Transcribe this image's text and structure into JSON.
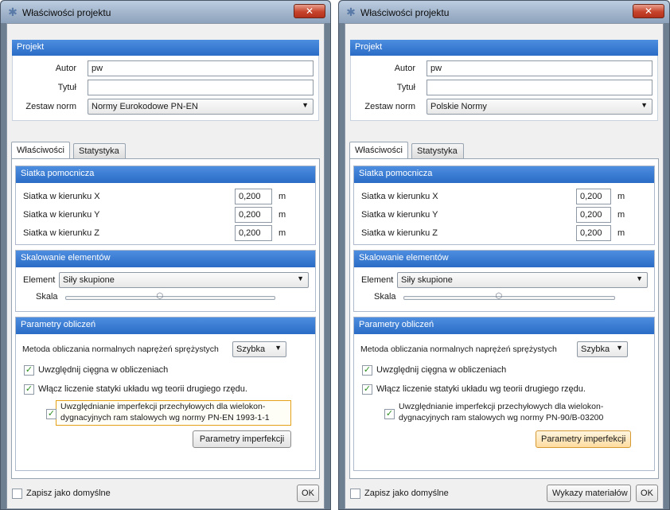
{
  "dialogs": [
    {
      "window_title": "Właściwości projektu",
      "close_glyph": "✕",
      "projekt": {
        "header": "Projekt",
        "autor_label": "Autor",
        "autor_value": "pw",
        "tytul_label": "Tytuł",
        "tytul_value": "",
        "zestaw_label": "Zestaw norm",
        "zestaw_value": "Normy Eurokodowe PN-EN"
      },
      "tabs": [
        "Właściwości",
        "Statystyka"
      ],
      "siatka": {
        "header": "Siatka pomocnicza",
        "rows": [
          {
            "label": "Siatka w kierunku X",
            "value": "0,200",
            "unit": "m"
          },
          {
            "label": "Siatka w kierunku Y",
            "value": "0,200",
            "unit": "m"
          },
          {
            "label": "Siatka w kierunku Z",
            "value": "0,200",
            "unit": "m"
          }
        ]
      },
      "skalowanie": {
        "header": "Skalowanie elementów",
        "element_label": "Element",
        "element_value": "Siły skupione",
        "skala_label": "Skala",
        "slider_level": 0.45
      },
      "parametry": {
        "header": "Parametry obliczeń",
        "metoda_label": "Metoda obliczania normalnych naprężeń sprężystych",
        "metoda_value": "Szybka",
        "check1": "Uwzględnij cięgna w obliczeniach",
        "check2": "Włącz liczenie statyki układu wg teorii drugiego rzędu.",
        "check3_line1": "Uwzględnianie imperfekcji przechyłowych dla wielokon-",
        "check3_line2": "dygnacyjnych ram stalowych wg normy PN-EN 1993-1-1",
        "imperf_button": "Parametry imperfekcji"
      },
      "footer": {
        "save_default": "Zapisz jako domyślne",
        "ok": "OK"
      }
    },
    {
      "window_title": "Właściwości projektu",
      "close_glyph": "✕",
      "projekt": {
        "header": "Projekt",
        "autor_label": "Autor",
        "autor_value": "pw",
        "tytul_label": "Tytuł",
        "tytul_value": "",
        "zestaw_label": "Zestaw norm",
        "zestaw_value": "Polskie Normy"
      },
      "tabs": [
        "Właściwości",
        "Statystyka"
      ],
      "siatka": {
        "header": "Siatka pomocnicza",
        "rows": [
          {
            "label": "Siatka w kierunku X",
            "value": "0,200",
            "unit": "m"
          },
          {
            "label": "Siatka w kierunku Y",
            "value": "0,200",
            "unit": "m"
          },
          {
            "label": "Siatka w kierunku Z",
            "value": "0,200",
            "unit": "m"
          }
        ]
      },
      "skalowanie": {
        "header": "Skalowanie elementów",
        "element_label": "Element",
        "element_value": "Siły skupione",
        "skala_label": "Skala",
        "slider_level": 0.45
      },
      "parametry": {
        "header": "Parametry obliczeń",
        "metoda_label": "Metoda obliczania normalnych naprężeń sprężystych",
        "metoda_value": "Szybka",
        "check1": "Uwzględnij cięgna w obliczeniach",
        "check2": "Włącz liczenie statyki układu wg teorii drugiego rzędu.",
        "check3_line1": "Uwzględnianie imperfekcji przechyłowych dla wielokon-",
        "check3_line2": "dygnacyjnych ram stalowych wg normy PN-90/B-03200",
        "imperf_button": "Parametry imperfekcji"
      },
      "footer": {
        "save_default": "Zapisz jako domyślne",
        "materials": "Wykazy materiałów",
        "ok": "OK"
      }
    }
  ]
}
